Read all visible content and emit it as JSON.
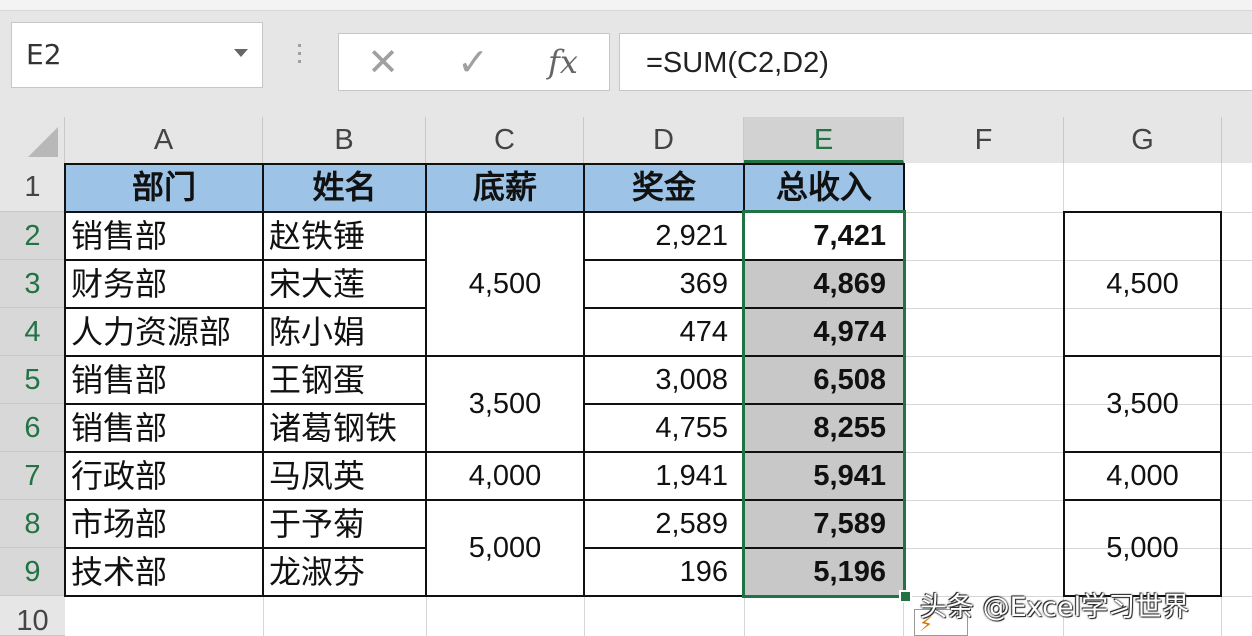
{
  "name_box": {
    "value": "E2"
  },
  "formula_bar": {
    "formula": "=SUM(C2,D2)",
    "cancel_icon": "✕",
    "enter_icon": "✓",
    "fx_label": "fx"
  },
  "columns": [
    "A",
    "B",
    "C",
    "D",
    "E",
    "F",
    "G"
  ],
  "rows": [
    "1",
    "2",
    "3",
    "4",
    "5",
    "6",
    "7",
    "8",
    "9",
    "10"
  ],
  "headers": {
    "a": "部门",
    "b": "姓名",
    "c": "底薪",
    "d": "奖金",
    "e": "总收入"
  },
  "data": [
    {
      "dept": "销售部",
      "name": "赵铁锤",
      "bonus": "2,921",
      "total": "7,421"
    },
    {
      "dept": "财务部",
      "name": "宋大莲",
      "bonus": "369",
      "total": "4,869"
    },
    {
      "dept": "人力资源部",
      "name": "陈小娟",
      "bonus": "474",
      "total": "4,974"
    },
    {
      "dept": "销售部",
      "name": "王钢蛋",
      "bonus": "3,008",
      "total": "6,508"
    },
    {
      "dept": "销售部",
      "name": "诸葛钢铁",
      "bonus": "4,755",
      "total": "8,255"
    },
    {
      "dept": "行政部",
      "name": "马凤英",
      "bonus": "1,941",
      "total": "5,941"
    },
    {
      "dept": "市场部",
      "name": "于予菊",
      "bonus": "2,589",
      "total": "7,589"
    },
    {
      "dept": "技术部",
      "name": "龙淑芬",
      "bonus": "196",
      "total": "5,196"
    }
  ],
  "base_salary_groups": [
    "4,500",
    "3,500",
    "4,000",
    "5,000"
  ],
  "g_groups": [
    "4,500",
    "3,500",
    "4,000",
    "5,000"
  ],
  "watermark": "头条 @Excel学习世界",
  "colors": {
    "header_fill": "#9dc3e6",
    "selection": "#217346",
    "selected_fill": "#c8c8c8"
  }
}
